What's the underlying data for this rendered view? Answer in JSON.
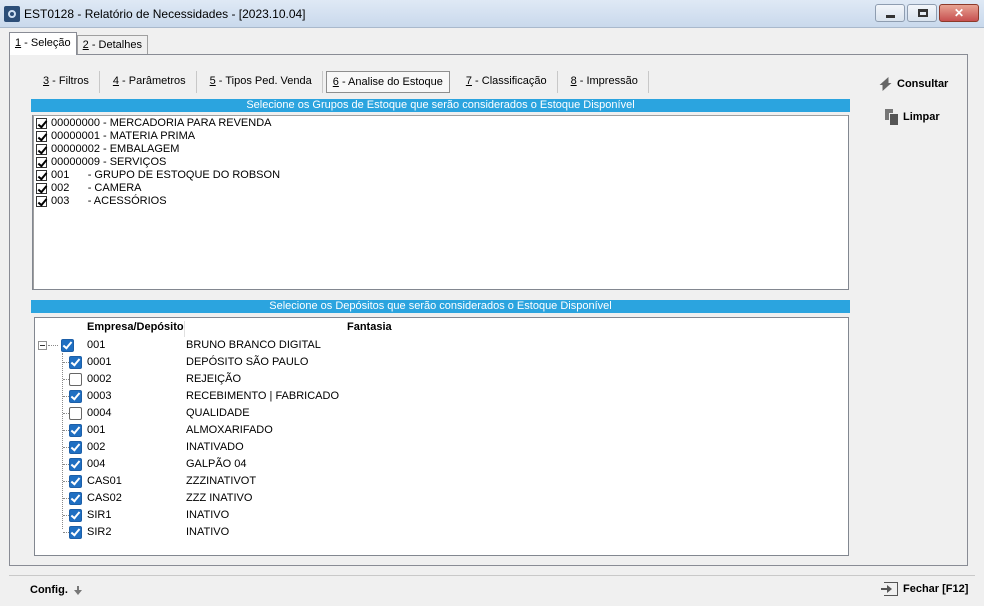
{
  "window": {
    "title": "EST0128 - Relatório de Necessidades - [2023.10.04]"
  },
  "main_tabs": [
    {
      "key": "1",
      "label": " - Seleção",
      "active": true
    },
    {
      "key": "2",
      "label": " - Detalhes",
      "active": false
    }
  ],
  "sub_tabs": [
    {
      "key": "3",
      "label": " - Filtros"
    },
    {
      "key": "4",
      "label": " - Parâmetros"
    },
    {
      "key": "5",
      "label": " - Tipos Ped. Venda"
    },
    {
      "key": "6",
      "label": " - Analise do Estoque"
    },
    {
      "key": "7",
      "label": " - Classificação"
    },
    {
      "key": "8",
      "label": " - Impressão"
    }
  ],
  "stock_groups": {
    "header": "Selecione os Grupos de Estoque que serão considerados o Estoque Disponível",
    "items": [
      {
        "label": "00000000 - MERCADORIA PARA REVENDA",
        "checked": true
      },
      {
        "label": "00000001 - MATERIA PRIMA",
        "checked": true
      },
      {
        "label": "00000002 - EMBALAGEM",
        "checked": true
      },
      {
        "label": "00000009 - SERVIÇOS",
        "checked": true
      },
      {
        "label": "001      - GRUPO DE ESTOQUE DO ROBSON",
        "checked": true
      },
      {
        "label": "002      - CAMERA",
        "checked": true
      },
      {
        "label": "003      - ACESSÓRIOS",
        "checked": true
      }
    ]
  },
  "deposits": {
    "header": "Selecione os Depósitos que serão considerados o Estoque Disponível",
    "col_code": "Empresa/Depósito",
    "col_fantasia": "Fantasia",
    "root": {
      "code": "001",
      "fantasia": "BRUNO BRANCO DIGITAL",
      "checked": true
    },
    "children": [
      {
        "code": "0001",
        "fantasia": "DEPÓSITO SÃO PAULO",
        "checked": true
      },
      {
        "code": "0002",
        "fantasia": "REJEIÇÃO",
        "checked": false
      },
      {
        "code": "0003",
        "fantasia": "RECEBIMENTO | FABRICADO",
        "checked": true
      },
      {
        "code": "0004",
        "fantasia": "QUALIDADE",
        "checked": false
      },
      {
        "code": "001",
        "fantasia": "ALMOXARIFADO",
        "checked": true
      },
      {
        "code": "002",
        "fantasia": "INATIVADO",
        "checked": true
      },
      {
        "code": "004",
        "fantasia": "GALPÃO 04",
        "checked": true
      },
      {
        "code": "CAS01",
        "fantasia": "ZZZINATIVOT",
        "checked": true
      },
      {
        "code": "CAS02",
        "fantasia": "ZZZ INATIVO",
        "checked": true
      },
      {
        "code": "SIR1",
        "fantasia": "INATIVO",
        "checked": true
      },
      {
        "code": "SIR2",
        "fantasia": "INATIVO",
        "checked": true
      }
    ]
  },
  "actions": {
    "consultar": "Consultar",
    "limpar": "Limpar",
    "config": "Config.",
    "fechar": "Fechar [F12]"
  },
  "colors": {
    "section_header": "#2ba4df",
    "checkbox_blue": "#1f6fc2"
  }
}
